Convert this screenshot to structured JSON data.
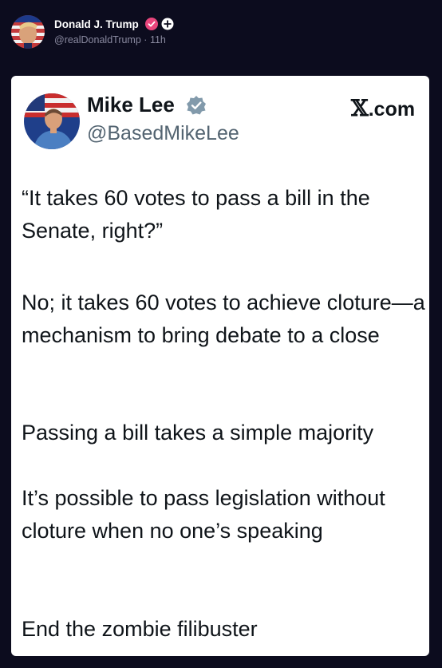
{
  "post": {
    "author_name": "Donald J. Trump",
    "handle": "@realDonaldTrump",
    "separator": "·",
    "time": "11h"
  },
  "embedded_tweet": {
    "name": "Mike Lee",
    "handle": "@BasedMikeLee",
    "source_label": ".com",
    "source_mark": "𝕏",
    "paragraphs": [
      "“It takes 60 votes to pass a bill in the Senate, right?”",
      "No; it takes 60 votes to achieve cloture—a mechanism to bring debate to a close",
      "Passing a bill takes a simple majority",
      "It’s possible to pass legislation without cloture when no one’s speaking",
      "End the zombie filibuster"
    ]
  },
  "icons": {
    "author_verified": "verified-badge-icon",
    "author_plus": "plus-icon",
    "embed_verified": "verified-badge-icon",
    "source_logo": "x-logo-icon"
  },
  "colors": {
    "page_background": "#0c0c1e",
    "card_background": "#ffffff",
    "verified_pink": "#e8457c",
    "verified_gray": "#829aab",
    "handle_text": "#8a8aa0"
  }
}
